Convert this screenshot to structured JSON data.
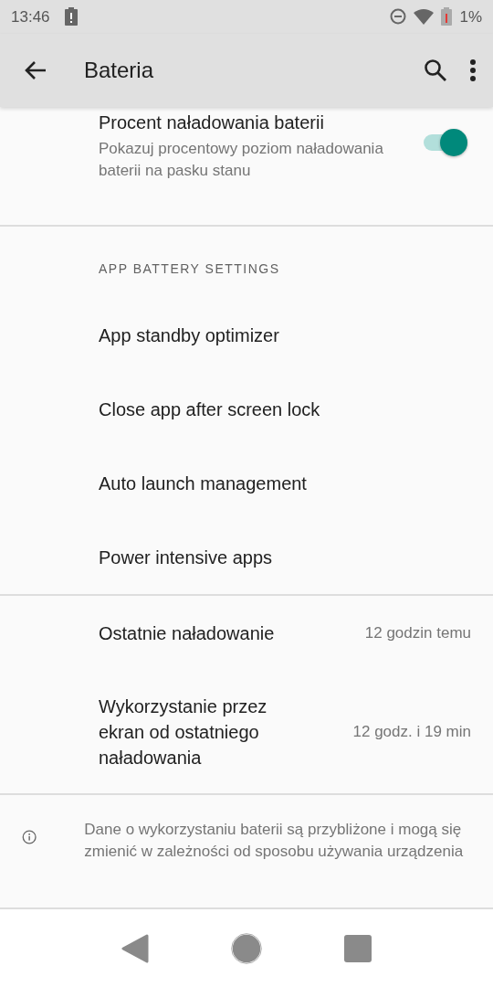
{
  "status_bar": {
    "time": "13:46",
    "battery_level_text": "1%"
  },
  "app_bar": {
    "title": "Bateria"
  },
  "toggle_setting": {
    "title": "Procent naładowania baterii",
    "summary": "Pokazuj procentowy poziom naładowania baterii na pasku stanu",
    "on": true
  },
  "section_header": "APP BATTERY SETTINGS",
  "menu_items": [
    "App standby optimizer",
    "Close app after screen lock",
    "Auto launch management",
    "Power intensive apps"
  ],
  "info_rows": [
    {
      "label": "Ostatnie naładowanie",
      "value": "12 godzin temu"
    },
    {
      "label": "Wykorzystanie przez ekran od ostatniego naładowania",
      "value": "12 godz. i 19 min"
    }
  ],
  "footer_note": "Dane o wykorzystaniu baterii są przybliżone i mogą się zmienić w zależności od sposobu używania urządzenia"
}
